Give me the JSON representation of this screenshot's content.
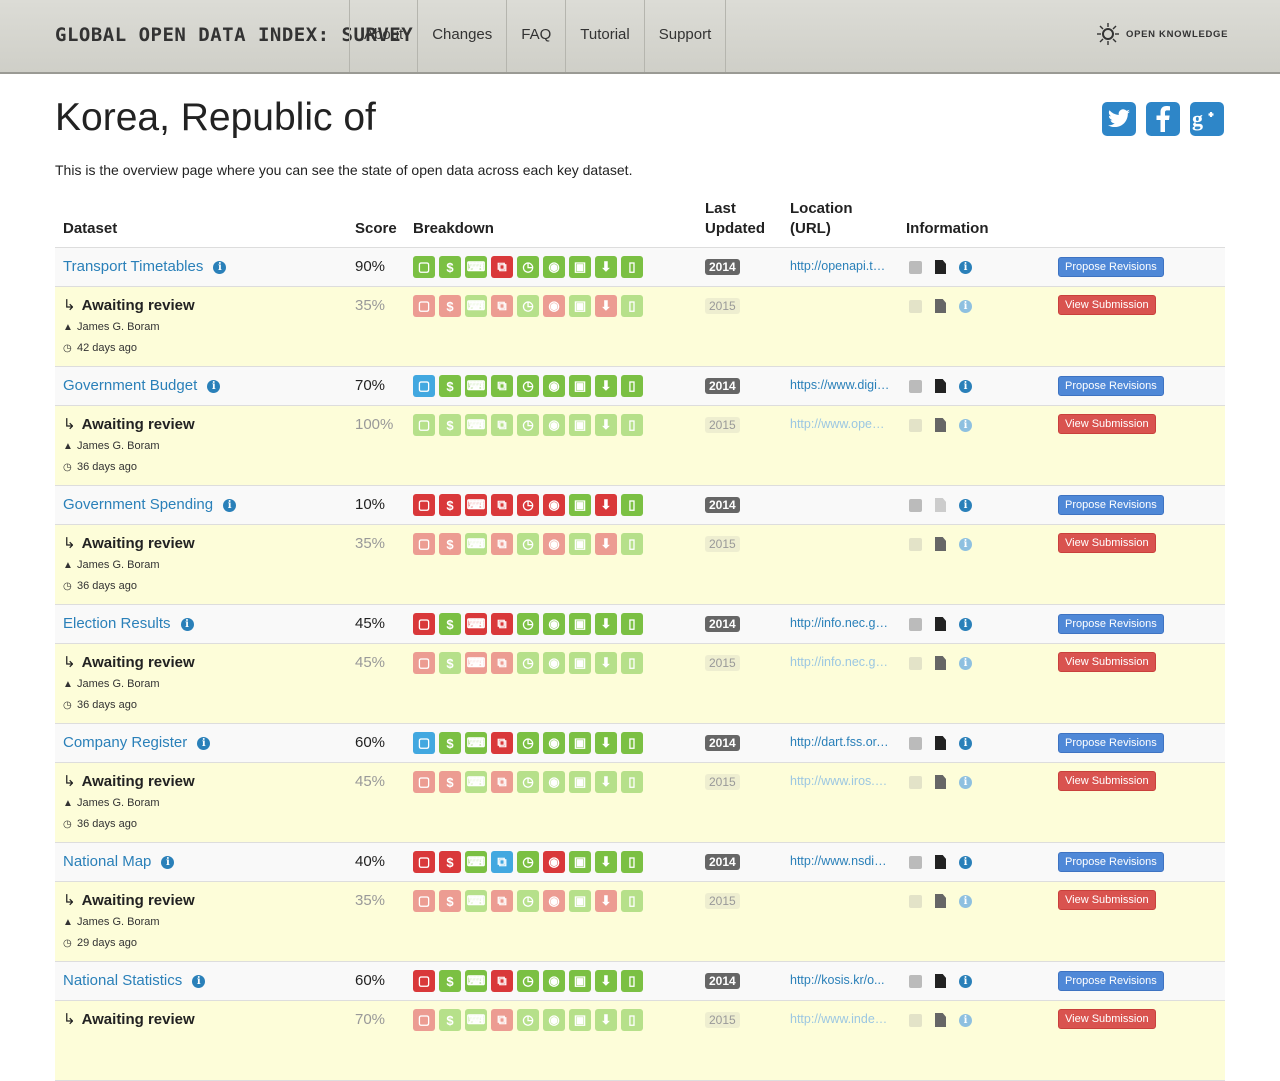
{
  "header": {
    "brand": "GLOBAL OPEN DATA INDEX: SURVEY",
    "nav": [
      "About",
      "Changes",
      "FAQ",
      "Tutorial",
      "Support"
    ],
    "logo_text": "OPEN KNOWLEDGE"
  },
  "page": {
    "title": "Korea, Republic of",
    "intro": "This is the overview page where you can see the state of open data across each key dataset.",
    "social": [
      "twitter-icon",
      "facebook-icon",
      "google-plus-icon"
    ]
  },
  "table": {
    "headers": {
      "dataset": "Dataset",
      "score": "Score",
      "breakdown": "Breakdown",
      "last_updated_1": "Last",
      "last_updated_2": "Updated",
      "location_1": "Location",
      "location_2": "(URL)",
      "information": "Information"
    },
    "breakdown_icons": [
      "unlock-icon",
      "dollar-icon",
      "keyboard-icon",
      "copy-icon",
      "clock-icon",
      "eye-icon",
      "save-icon",
      "download-icon",
      "file-icon"
    ],
    "colors": {
      "green": "#7bc043",
      "red": "#d9383a",
      "blue": "#42a8e0"
    },
    "propose_label": "Propose Revisions",
    "view_label": "View Submission",
    "awaiting_label": "Awaiting review",
    "rows": [
      {
        "name": "Transport Timetables",
        "score": "90%",
        "breakdown": [
          "g",
          "g",
          "g",
          "r",
          "g",
          "g",
          "g",
          "g",
          "g"
        ],
        "year": "2014",
        "url": "http://openapi.tago.go.kr/",
        "sub": {
          "score": "35%",
          "breakdown": [
            "r",
            "r",
            "g",
            "r",
            "g",
            "r",
            "g",
            "r",
            "g"
          ],
          "year": "2015",
          "url": "",
          "author": "James G. Boram",
          "ago": "42 days ago"
        }
      },
      {
        "name": "Government Budget",
        "score": "70%",
        "breakdown": [
          "b",
          "g",
          "g",
          "g",
          "g",
          "g",
          "g",
          "g",
          "g"
        ],
        "year": "2014",
        "url": "https://www.digitalbrain.go.kr/",
        "sub": {
          "score": "100%",
          "breakdown": [
            "g",
            "g",
            "g",
            "g",
            "g",
            "g",
            "g",
            "g",
            "g"
          ],
          "year": "2015",
          "url": "http://www.openfiscaldata.go.kr/",
          "author": "James G. Boram",
          "ago": "36 days ago"
        }
      },
      {
        "name": "Government Spending",
        "score": "10%",
        "breakdown": [
          "r",
          "r",
          "r",
          "r",
          "r",
          "r",
          "g",
          "r",
          "g"
        ],
        "year": "2014",
        "url": "",
        "sub": {
          "score": "35%",
          "breakdown": [
            "r",
            "r",
            "g",
            "r",
            "g",
            "r",
            "g",
            "r",
            "g"
          ],
          "year": "2015",
          "url": "",
          "author": "James G. Boram",
          "ago": "36 days ago"
        }
      },
      {
        "name": "Election Results",
        "score": "45%",
        "breakdown": [
          "r",
          "g",
          "r",
          "r",
          "g",
          "g",
          "g",
          "g",
          "g"
        ],
        "year": "2014",
        "url": "http://info.nec.go.kr/",
        "sub": {
          "score": "45%",
          "breakdown": [
            "r",
            "g",
            "r",
            "r",
            "g",
            "g",
            "g",
            "g",
            "g"
          ],
          "year": "2015",
          "url": "http://info.nec.go.kr/",
          "author": "James G. Boram",
          "ago": "36 days ago"
        }
      },
      {
        "name": "Company Register",
        "score": "60%",
        "breakdown": [
          "b",
          "g",
          "g",
          "r",
          "g",
          "g",
          "g",
          "g",
          "g"
        ],
        "year": "2014",
        "url": "http://dart.fss.or.kr/",
        "sub": {
          "score": "45%",
          "breakdown": [
            "r",
            "r",
            "g",
            "r",
            "g",
            "g",
            "g",
            "g",
            "g"
          ],
          "year": "2015",
          "url": "http://www.iros.go.kr/",
          "author": "James G. Boram",
          "ago": "36 days ago"
        }
      },
      {
        "name": "National Map",
        "score": "40%",
        "breakdown": [
          "r",
          "r",
          "g",
          "b",
          "g",
          "r",
          "g",
          "g",
          "g"
        ],
        "year": "2014",
        "url": "http://www.nsdi.go.kr/",
        "sub": {
          "score": "35%",
          "breakdown": [
            "r",
            "r",
            "g",
            "r",
            "g",
            "r",
            "g",
            "r",
            "g"
          ],
          "year": "2015",
          "url": "",
          "author": "James G. Boram",
          "ago": "29 days ago"
        }
      },
      {
        "name": "National Statistics",
        "score": "60%",
        "breakdown": [
          "r",
          "g",
          "g",
          "r",
          "g",
          "g",
          "g",
          "g",
          "g"
        ],
        "year": "2014",
        "url": "http://kosis.kr/o...",
        "sub": {
          "score": "70%",
          "breakdown": [
            "r",
            "g",
            "g",
            "r",
            "g",
            "g",
            "g",
            "g",
            "g"
          ],
          "year": "2015",
          "url": "http://www.index.go.kr/",
          "author": "",
          "ago": ""
        }
      }
    ]
  }
}
